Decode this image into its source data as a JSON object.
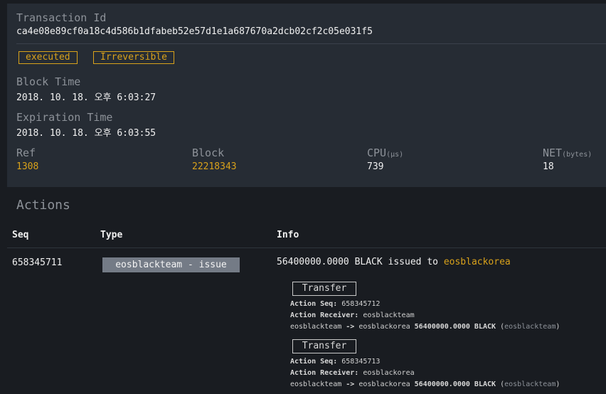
{
  "transaction": {
    "id_label": "Transaction Id",
    "id_value": "ca4e08e89cf0a18c4d586b1dfabeb52e57d1e1a687670a2dcb02cf2c05e031f5",
    "badges": [
      "executed",
      "Irreversible"
    ],
    "block_time_label": "Block Time",
    "block_time_value": "2018. 10. 18. 오후 6:03:27",
    "expiration_label": "Expiration Time",
    "expiration_value": "2018. 10. 18. 오후 6:03:55",
    "stats": {
      "ref_label": "Ref",
      "ref_value": "1308",
      "block_label": "Block",
      "block_value": "22218343",
      "cpu_label": "CPU",
      "cpu_unit": "(μs)",
      "cpu_value": "739",
      "net_label": "NET",
      "net_unit": "(bytes)",
      "net_value": "18"
    }
  },
  "actions": {
    "title": "Actions",
    "columns": [
      "Seq",
      "Type",
      "Info"
    ],
    "rows": [
      {
        "seq": "658345711",
        "type": "eosblackteam - issue",
        "info_text": "56400000.0000 BLACK issued to ",
        "info_account": "eosblackorea",
        "traces": [
          {
            "button": "Transfer",
            "seq_label": "Action Seq:",
            "seq_value": "658345712",
            "receiver_label": "Action Receiver:",
            "receiver_value": "eosblackteam",
            "from": "eosblackteam",
            "arrow": "->",
            "to": "eosblackorea",
            "amount": "56400000.0000 BLACK",
            "memo_open": "(",
            "memo": "eosblackteam",
            "memo_close": ")"
          },
          {
            "button": "Transfer",
            "seq_label": "Action Seq:",
            "seq_value": "658345713",
            "receiver_label": "Action Receiver:",
            "receiver_value": "eosblackorea",
            "from": "eosblackteam",
            "arrow": "->",
            "to": "eosblackorea",
            "amount": "56400000.0000 BLACK",
            "memo_open": "(",
            "memo": "eosblackteam",
            "memo_close": ")"
          }
        ]
      }
    ]
  }
}
